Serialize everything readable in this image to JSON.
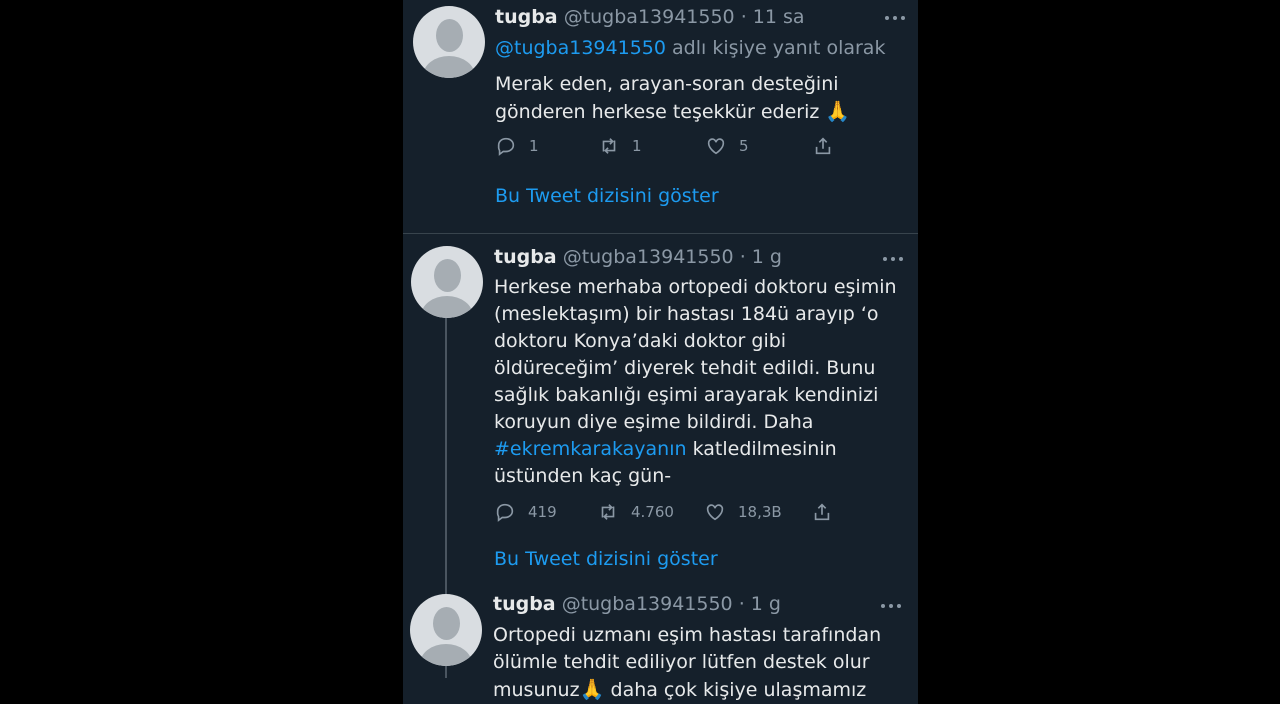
{
  "colors": {
    "background": "#15202b",
    "text": "#e7e9ea",
    "secondary": "#8b98a5",
    "accent": "#1d9bf0"
  },
  "tweets": [
    {
      "name": "tugba",
      "handle": "@tugba13941550",
      "separator": "·",
      "time": "11 sa",
      "replying_mention": "@tugba13941550",
      "replying_suffix": "adlı kişiye yanıt olarak",
      "text": "Merak eden, arayan-soran desteğini\ngönderen herkese teşekkür ederiz",
      "emoji": "🙏",
      "replies": "1",
      "retweets": "1",
      "likes": "5",
      "show_thread": "Bu Tweet dizisini göster"
    },
    {
      "name": "tugba",
      "handle": "@tugba13941550",
      "separator": "·",
      "time": "1 g",
      "text_before": "Herkese merhaba ortopedi doktoru eşimin\n(meslektaşım) bir hastası 184ü arayıp ‘o\ndoktoru Konya’daki doktor gibi\nöldüreceğim’ diyerek tehdit edildi. Bunu\nsağlık bakanlığı eşimi arayarak kendinizi\nkoruyun diye eşime bildirdi. Daha\n",
      "hashtag": "#ekremkarakayanın",
      "text_after": " katledilmesinin\nüstünden kaç gün-",
      "replies": "419",
      "retweets": "4.760",
      "likes": "18,3B",
      "show_thread": "Bu Tweet dizisini göster"
    },
    {
      "name": "tugba",
      "handle": "@tugba13941550",
      "separator": "·",
      "time": "1 g",
      "text_before": "Ortopedi uzmanı eşim hastası tarafından\nölümle tehdit ediliyor lütfen destek olur\nmusunuz",
      "emoji": "🙏",
      "text_after": " daha çok kişiye ulaşmamız"
    }
  ],
  "icons": [
    "reply-icon",
    "retweet-icon",
    "like-icon",
    "share-icon",
    "more-icon"
  ]
}
